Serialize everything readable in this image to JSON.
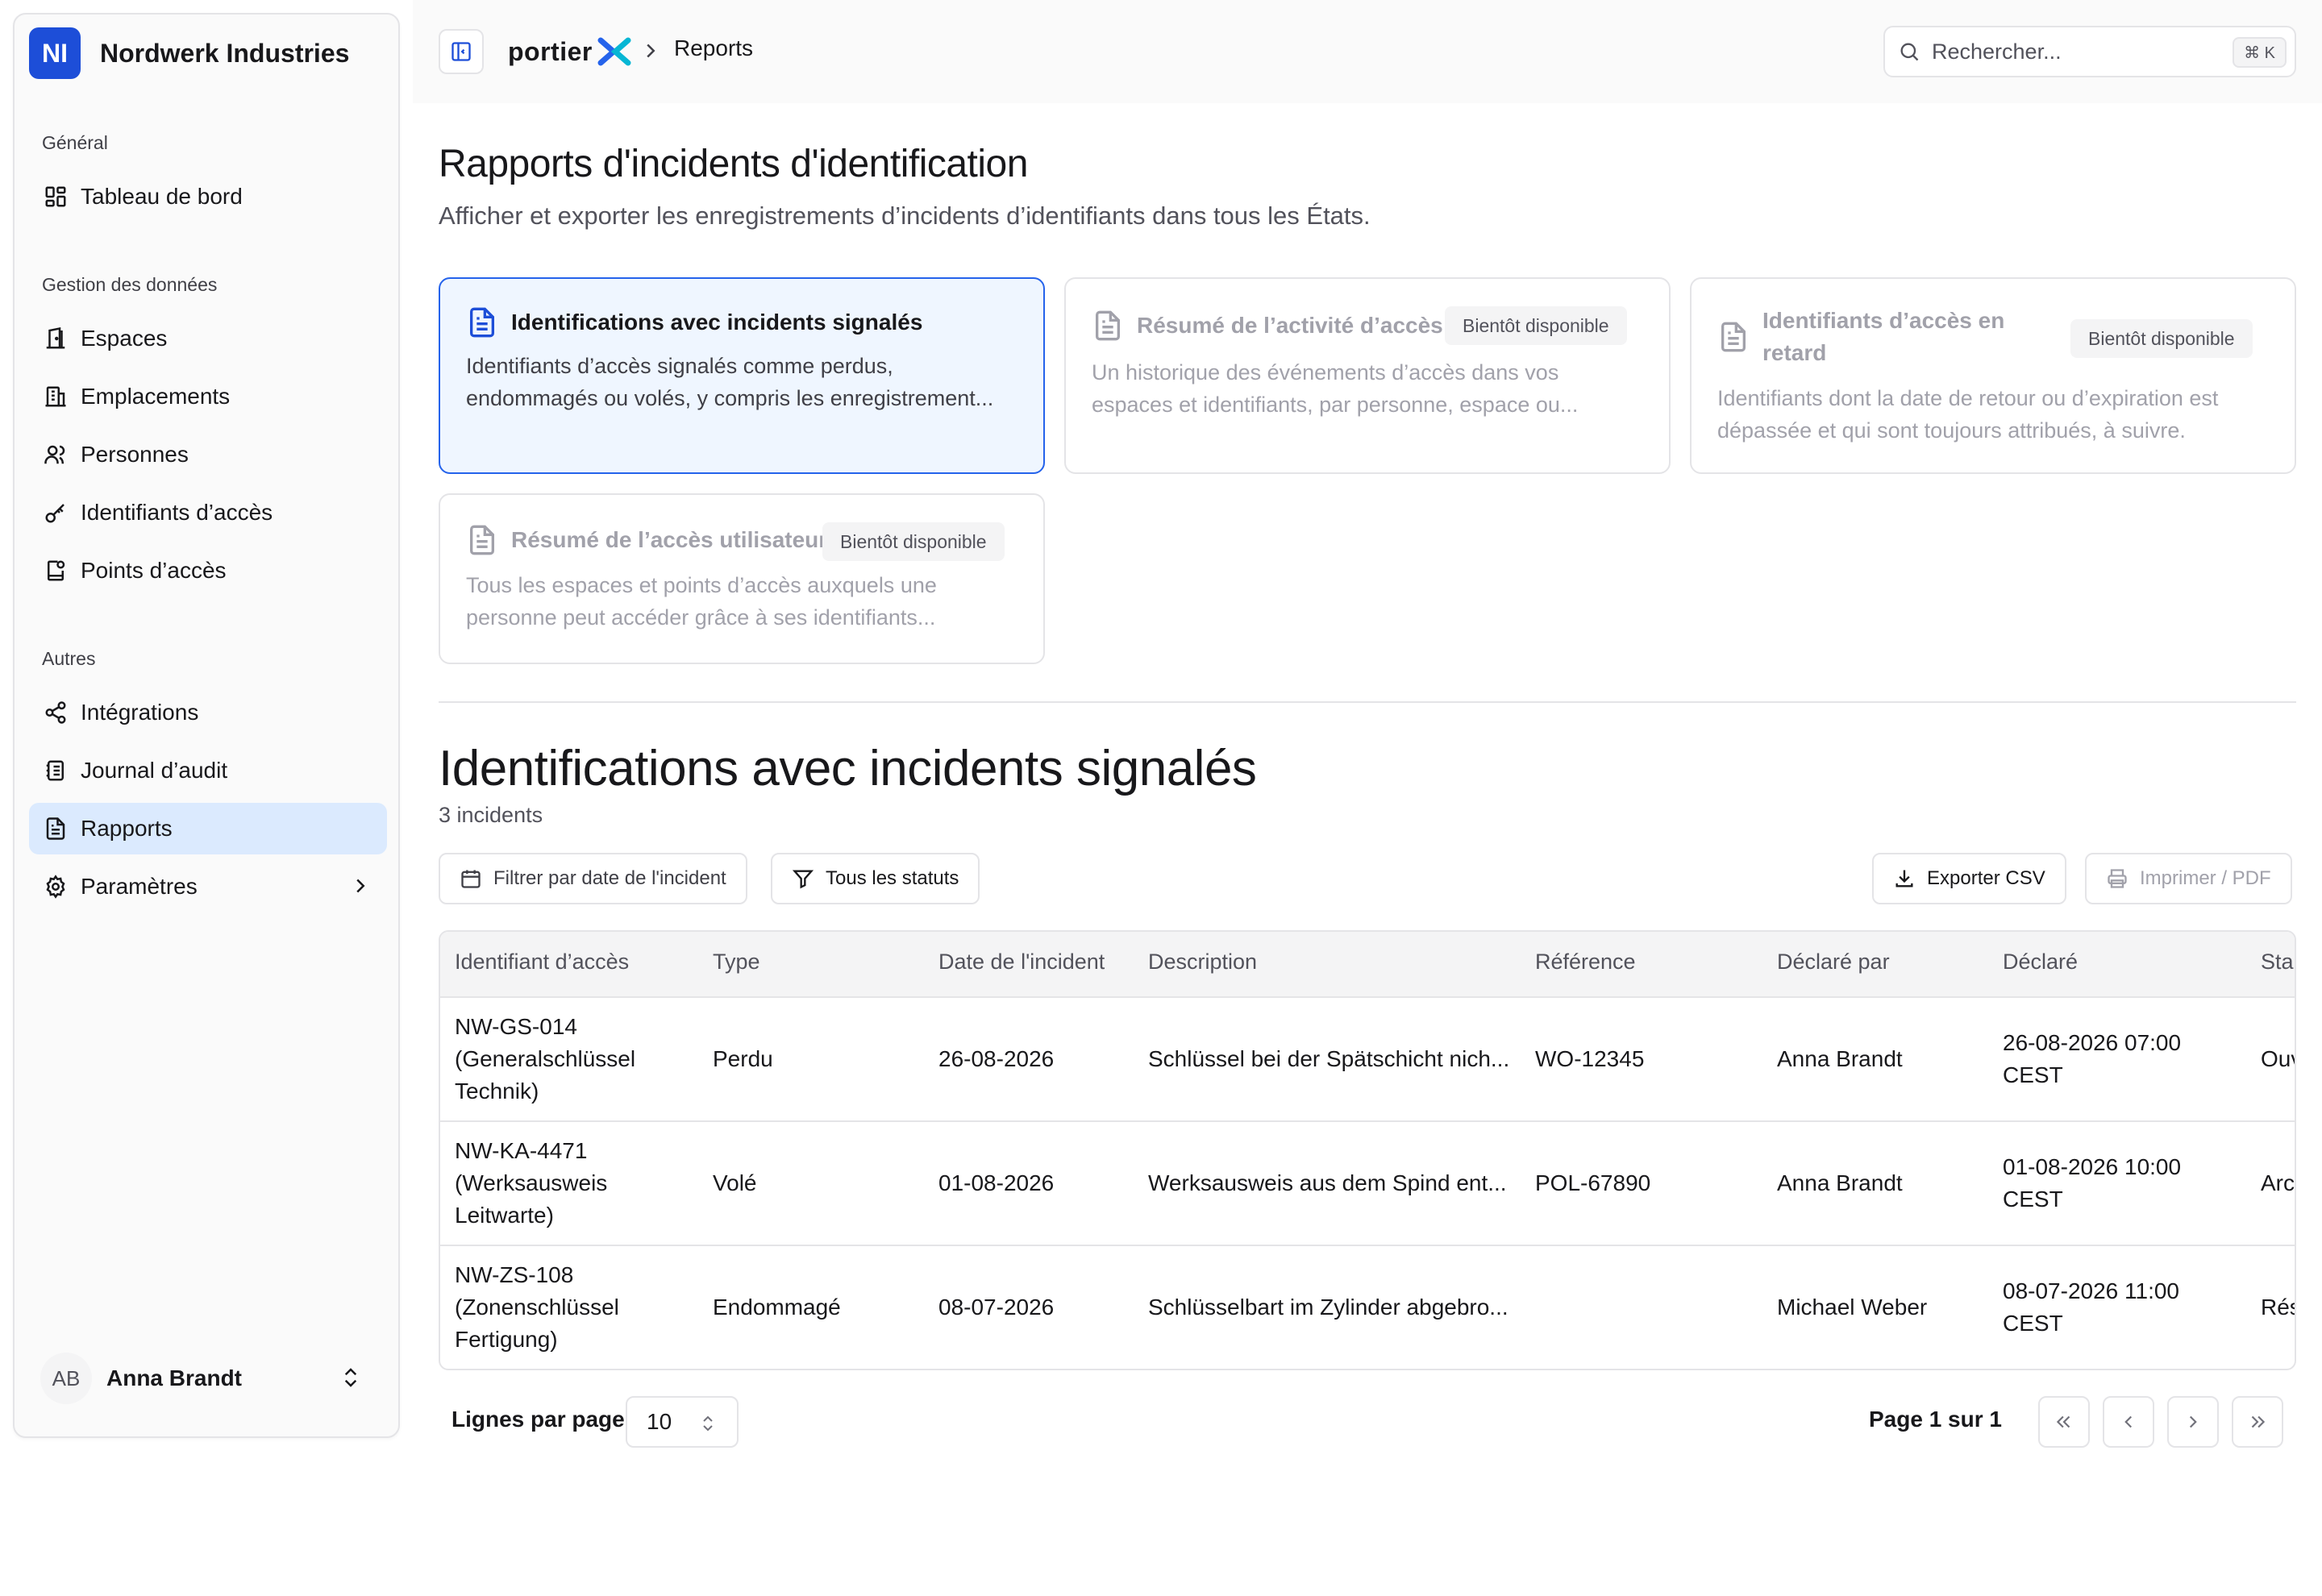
{
  "sidebar": {
    "org_initials": "NI",
    "org_name": "Nordwerk Industries",
    "sections": {
      "general": "Général",
      "data": "Gestion des données",
      "other": "Autres"
    },
    "items": {
      "dashboard": "Tableau de bord",
      "spaces": "Espaces",
      "locations": "Emplacements",
      "people": "Personnes",
      "credentials": "Identifiants d’accès",
      "access_points": "Points d’accès",
      "integrations": "Intégrations",
      "audit_log": "Journal d’audit",
      "reports": "Rapports",
      "settings": "Paramètres"
    },
    "user": {
      "initials": "AB",
      "name": "Anna Brandt"
    }
  },
  "topbar": {
    "brand": "portier",
    "breadcrumb": "Reports",
    "search_placeholder": "Rechercher...",
    "shortcut": "⌘ K"
  },
  "header": {
    "title": "Rapports d'incidents d'identification",
    "subtitle": "Afficher et exporter les enregistrements d’incidents d’identifiants dans tous les États."
  },
  "report_cards": [
    {
      "title": "Identifications avec incidents signalés",
      "desc": "Identifiants d’accès signalés comme perdus, endommagés ou volés, y compris les enregistrement...",
      "badge": ""
    },
    {
      "title": "Résumé de l’activité d’accès",
      "desc": "Un historique des événements d’accès dans vos espaces et identifiants, par personne, espace ou...",
      "badge": "Bientôt disponible"
    },
    {
      "title": "Identifiants d’accès en retard",
      "desc": "Identifiants dont la date de retour ou d’expiration est dépassée et qui sont toujours attribués, à suivre.",
      "badge": "Bientôt disponible"
    },
    {
      "title": "Résumé de l’accès utilisateur",
      "desc": "Tous les espaces et points d’accès auxquels une personne peut accéder grâce à ses identifiants...",
      "badge": "Bientôt disponible"
    }
  ],
  "section": {
    "title": "Identifications avec incidents signalés",
    "count": "3 incidents",
    "filter_date": "Filtrer par date de l'incident",
    "filter_status": "Tous les statuts",
    "export_csv": "Exporter CSV",
    "print_pdf": "Imprimer / PDF"
  },
  "table": {
    "columns": [
      "Identifiant d’accès",
      "Type",
      "Date de l'incident",
      "Description",
      "Référence",
      "Déclaré par",
      "Déclaré",
      "Sta"
    ],
    "rows": [
      {
        "credential": "NW-GS-014 (Generalschlüssel Technik)",
        "type": "Perdu",
        "date": "26-08-2026",
        "description": "Schlüssel bei der Spätschicht nich...",
        "reference": "WO-12345",
        "reported_by": "Anna Brandt",
        "reported_at": "26-08-2026 07:00 CEST",
        "status": "Ouv"
      },
      {
        "credential": "NW-KA-4471 (Werksausweis Leitwarte)",
        "type": "Volé",
        "date": "01-08-2026",
        "description": "Werksausweis aus dem Spind ent...",
        "reference": "POL-67890",
        "reported_by": "Anna Brandt",
        "reported_at": "01-08-2026 10:00 CEST",
        "status": "Arc"
      },
      {
        "credential": "NW-ZS-108 (Zonenschlüssel Fertigung)",
        "type": "Endommagé",
        "date": "08-07-2026",
        "description": "Schlüsselbart im Zylinder abgebro...",
        "reference": "",
        "reported_by": "Michael Weber",
        "reported_at": "08-07-2026 11:00 CEST",
        "status": "Rés"
      }
    ]
  },
  "pagination": {
    "rows_label": "Lignes par page",
    "rows_value": "10",
    "page_info": "Page 1 sur 1"
  },
  "colors": {
    "accent": "#1d4ed8",
    "active_bg": "#dbeafe",
    "selected_border": "#2563eb",
    "border": "#e4e4e7"
  }
}
